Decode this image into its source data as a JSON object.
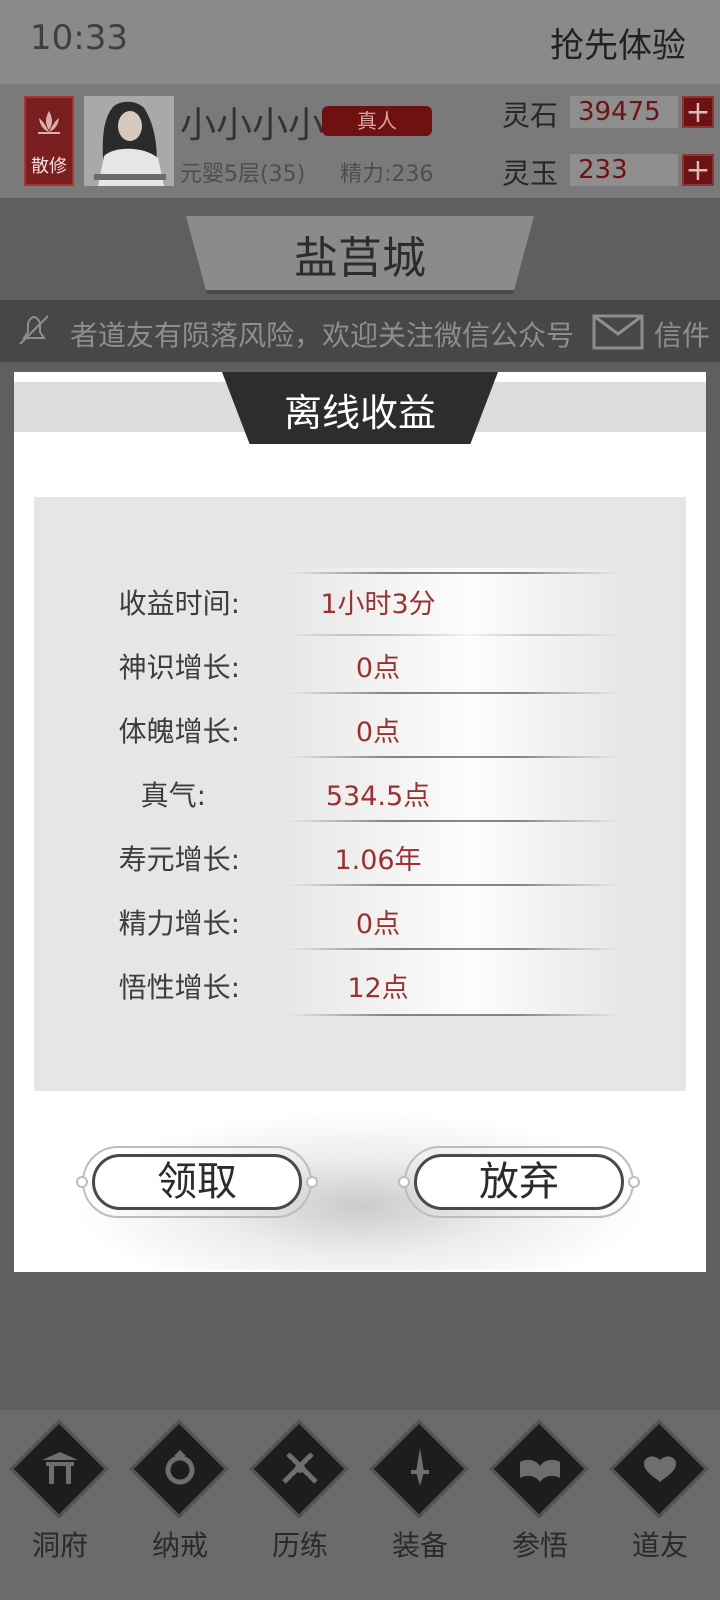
{
  "status_bar": {
    "time": "10:33",
    "right_text": "抢先体验"
  },
  "player": {
    "sect": "散修",
    "name": "小小小小",
    "rank_badge": "真人",
    "realm": "元婴5层(35)",
    "energy": "精力:236"
  },
  "currencies": [
    {
      "label": "灵石",
      "value": "39475"
    },
    {
      "label": "灵玉",
      "value": "233"
    }
  ],
  "plus_symbol": "+",
  "location": {
    "city": "盐莒城"
  },
  "marquee": {
    "text": "者道友有陨落风险，欢迎关注微信公众号",
    "mail_label": "信件"
  },
  "modal": {
    "title": "离线收益",
    "rows": [
      {
        "label": "收益时间:",
        "value": "1小时3分"
      },
      {
        "label": "神识增长:",
        "value": "0点"
      },
      {
        "label": "体魄增长:",
        "value": "0点"
      },
      {
        "label": "真气:",
        "value": "534.5点"
      },
      {
        "label": "寿元增长:",
        "value": "1.06年"
      },
      {
        "label": "精力增长:",
        "value": "0点"
      },
      {
        "label": "悟性增长:",
        "value": "12点"
      }
    ],
    "claim_label": "领取",
    "abandon_label": "放弃"
  },
  "bottom_nav": [
    {
      "label": "洞府",
      "icon": "gate-icon"
    },
    {
      "label": "纳戒",
      "icon": "ring-icon"
    },
    {
      "label": "历练",
      "icon": "crossed-swords-icon"
    },
    {
      "label": "装备",
      "icon": "sword-icon"
    },
    {
      "label": "参悟",
      "icon": "open-book-icon"
    },
    {
      "label": "道友",
      "icon": "friend-icon"
    }
  ]
}
